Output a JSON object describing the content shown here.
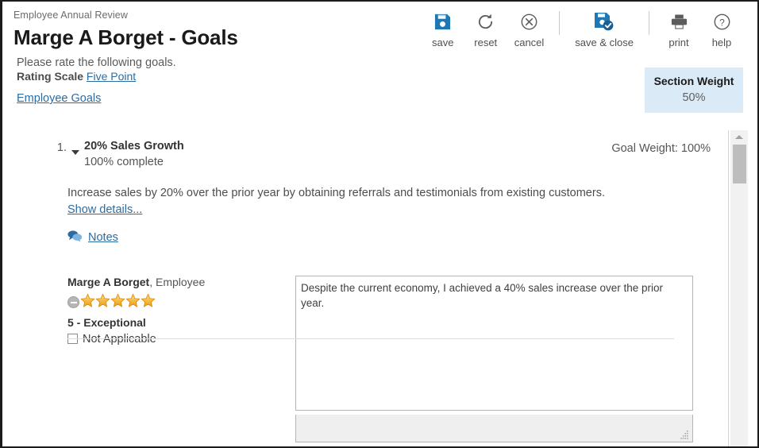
{
  "header": {
    "breadcrumb": "Employee Annual Review",
    "title": "Marge A Borget - Goals",
    "instructions": "Please rate the following goals.",
    "rating_scale_label": "Rating Scale",
    "rating_scale_value": "Five Point",
    "goals_link": "Employee Goals"
  },
  "toolbar": {
    "save_label": "save",
    "reset_label": "reset",
    "cancel_label": "cancel",
    "save_close_label": "save & close",
    "print_label": "print",
    "help_label": "help",
    "icons": {
      "save": "floppy-disk-icon",
      "reset": "refresh-icon",
      "cancel": "cancel-circle-icon",
      "save_close": "floppy-disk-check-icon",
      "print": "printer-icon",
      "help": "question-circle-icon"
    },
    "accent_color": "#1f78b4"
  },
  "section_weight": {
    "title": "Section Weight",
    "value": "50%",
    "background_color": "#dbeaf7"
  },
  "goal": {
    "number": "1.",
    "name": "20% Sales Growth",
    "completion": "100% complete",
    "weight": "Goal Weight: 100%",
    "description": "Increase sales by 20% over the prior year by obtaining referrals and testimonials from existing customers.",
    "show_details": "Show details...",
    "notes_label": "Notes"
  },
  "rating": {
    "rater_name": "Marge A Borget",
    "rater_role": ", Employee",
    "stars_total": 5,
    "stars_filled": 5,
    "star_color": "#f4a81d",
    "rating_text": "5 - Exceptional",
    "not_applicable_label": "Not Applicable",
    "not_applicable_checked": false
  },
  "comment": {
    "value": "Despite the current economy, I achieved a 40% sales increase over the prior year.",
    "placeholder": ""
  }
}
